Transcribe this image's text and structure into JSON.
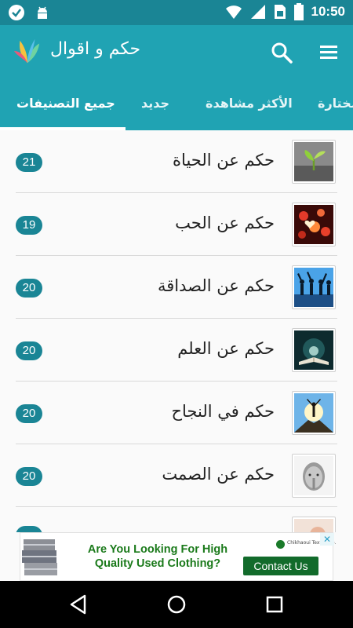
{
  "status_bar": {
    "time": "10:50",
    "icons": [
      "check-circle-icon",
      "android-icon",
      "wifi-icon",
      "signal-icon",
      "sim-icon",
      "battery-icon"
    ]
  },
  "app_bar": {
    "title": "حكم و اقوال",
    "icons": [
      "app-logo",
      "search-icon",
      "menu-icon"
    ]
  },
  "tabs": [
    {
      "label": "جميع التصنيفات",
      "active": true
    },
    {
      "label": "جديد",
      "active": false
    },
    {
      "label": "الأكثر مشاهدة",
      "active": false
    },
    {
      "label": "مختارة",
      "active": false
    }
  ],
  "categories": [
    {
      "title": "حكم عن الحياة",
      "count": "21",
      "icon": "sprout-image"
    },
    {
      "title": "حكم عن الحب",
      "count": "19",
      "icon": "hearts-image"
    },
    {
      "title": "حكم عن الصداقة",
      "count": "20",
      "icon": "friends-silhouette-image"
    },
    {
      "title": "حكم عن العلم",
      "count": "20",
      "icon": "glowing-book-image"
    },
    {
      "title": "حكم في النجاح",
      "count": "20",
      "icon": "summit-image"
    },
    {
      "title": "حكم عن الصمت",
      "count": "20",
      "icon": "silent-face-image"
    },
    {
      "title": "",
      "count": "",
      "icon": "partial-image"
    }
  ],
  "ad": {
    "headline": "Are You Looking For High Quality Used Clothing?",
    "cta": "Contact Us",
    "close": "✕",
    "brand": "Chikhaoui Textile Co."
  },
  "colors": {
    "primary": "#20a3b3",
    "primary_dark": "#1a8595",
    "badge": "#1a8595",
    "ad_text": "#1b7a1b",
    "ad_cta": "#126b2b"
  }
}
